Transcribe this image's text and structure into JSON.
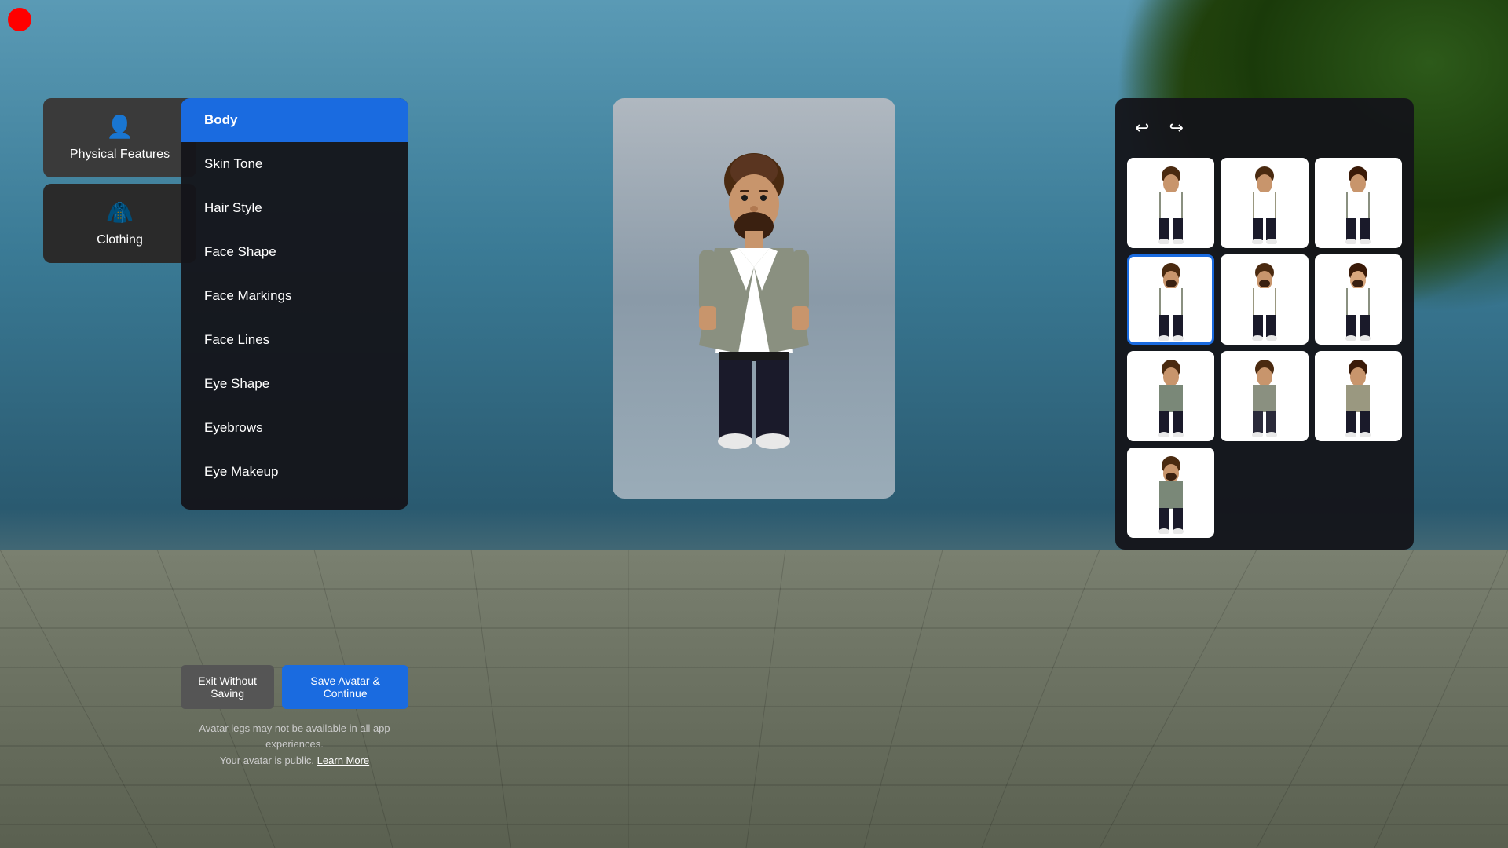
{
  "background": {
    "color_top": "#5a9ab5",
    "color_bottom": "#6a7060"
  },
  "left_sidebar": {
    "categories": [
      {
        "id": "physical-features",
        "label": "Physical Features",
        "icon": "👤",
        "active": true
      },
      {
        "id": "clothing",
        "label": "Clothing",
        "icon": "👕",
        "active": false
      }
    ]
  },
  "menu": {
    "items": [
      {
        "id": "body",
        "label": "Body",
        "active": true
      },
      {
        "id": "skin-tone",
        "label": "Skin Tone",
        "active": false
      },
      {
        "id": "hair-style",
        "label": "Hair Style",
        "active": false
      },
      {
        "id": "face-shape",
        "label": "Face Shape",
        "active": false
      },
      {
        "id": "face-markings",
        "label": "Face Markings",
        "active": false
      },
      {
        "id": "face-lines",
        "label": "Face Lines",
        "active": false
      },
      {
        "id": "eye-shape",
        "label": "Eye Shape",
        "active": false
      },
      {
        "id": "eyebrows",
        "label": "Eyebrows",
        "active": false
      },
      {
        "id": "eye-makeup",
        "label": "Eye Makeup",
        "active": false
      }
    ]
  },
  "buttons": {
    "exit": "Exit Without Saving",
    "save": "Save Avatar & Continue"
  },
  "footer": {
    "line1": "Avatar legs may not be available in all app experiences.",
    "line2": "Your avatar is public.",
    "learn_more": "Learn More"
  },
  "right_panel": {
    "undo_label": "↩",
    "redo_label": "↪",
    "selected_index": 3,
    "avatar_count": 10
  }
}
